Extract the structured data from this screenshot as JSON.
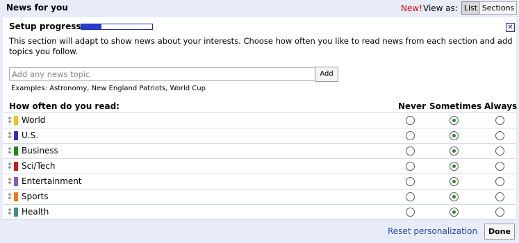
{
  "header": {
    "title": "News for you",
    "new_label": "New!",
    "view_as_label": "View as:",
    "list_label": "List",
    "sections_label": "Sections"
  },
  "setup": {
    "progress_label": "Setup progress:",
    "progress_fraction": 0.28,
    "close_icon": "close-icon",
    "description": "This section will adapt to show news about your interests. Choose how often you like to read news from each section and add topics you follow.",
    "topic_placeholder": "Add any news topic",
    "add_label": "Add",
    "examples": "Examples: Astronomy, New England Patriots, World Cup"
  },
  "frequency": {
    "heading": "How often do you read:",
    "columns": [
      "Never",
      "Sometimes",
      "Always"
    ],
    "rows": [
      {
        "label": "World",
        "color": "#f2c300",
        "selected": 1
      },
      {
        "label": "U.S.",
        "color": "#2a35b5",
        "selected": 1
      },
      {
        "label": "Business",
        "color": "#1c8a1c",
        "selected": 1
      },
      {
        "label": "Sci/Tech",
        "color": "#cc1a1a",
        "selected": 1
      },
      {
        "label": "Entertainment",
        "color": "#8b5cc0",
        "selected": 1
      },
      {
        "label": "Sports",
        "color": "#f07a12",
        "selected": 1
      },
      {
        "label": "Health",
        "color": "#3a8f86",
        "selected": 1
      }
    ]
  },
  "footer": {
    "reset_label": "Reset personalization",
    "done_label": "Done"
  }
}
